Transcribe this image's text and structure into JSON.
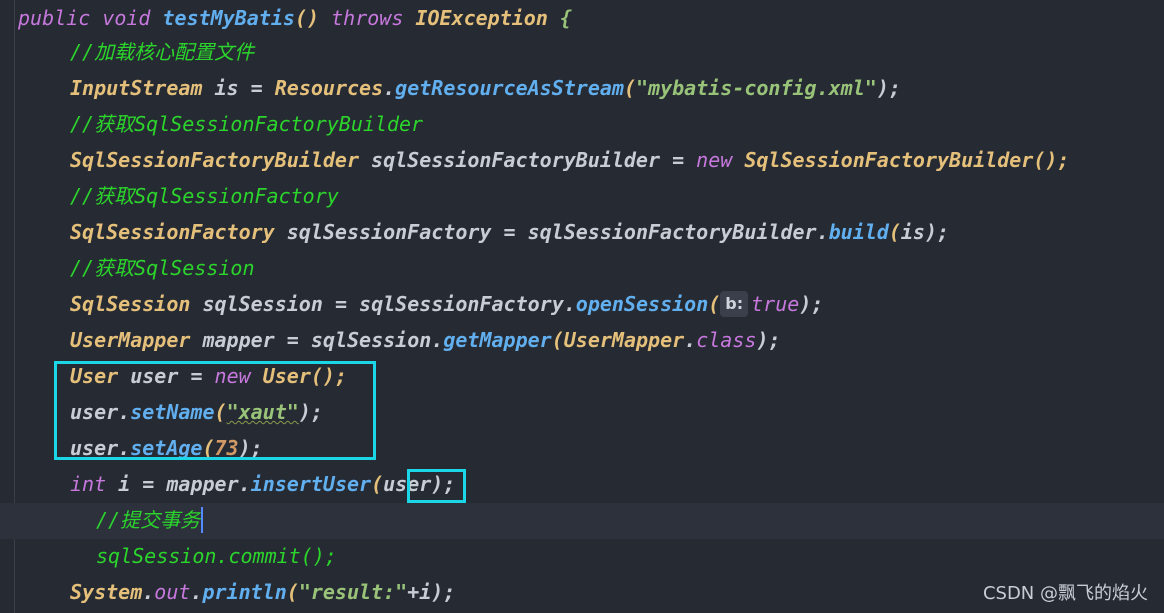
{
  "code": {
    "l1": {
      "mod1": "public",
      "mod2": "void",
      "name": "testMyBatis",
      "parens": "()",
      "throws": "throws",
      "exc": "IOException",
      "brace": "{"
    },
    "l2": {
      "comment": "//加载核心配置文件"
    },
    "l3": {
      "type": "InputStream",
      "var": "is",
      "eq": "=",
      "cls": "Resources",
      "dot": ".",
      "method": "getResourceAsStream",
      "open": "(",
      "arg": "\"mybatis-config.xml\"",
      "close": ");"
    },
    "l4": {
      "comment": "//获取SqlSessionFactoryBuilder"
    },
    "l5": {
      "type": "SqlSessionFactoryBuilder",
      "var": "sqlSessionFactoryBuilder",
      "eq": "=",
      "new": "new",
      "ctor": "SqlSessionFactoryBuilder",
      "close": "();"
    },
    "l6": {
      "comment": "//获取SqlSessionFactory"
    },
    "l7": {
      "type": "SqlSessionFactory",
      "var": "sqlSessionFactory",
      "eq": "=",
      "obj": "sqlSessionFactoryBuilder",
      "dot": ".",
      "method": "build",
      "open": "(",
      "arg": "is",
      "close": ");"
    },
    "l8": {
      "comment": "//获取SqlSession"
    },
    "l9": {
      "type": "SqlSession",
      "var": "sqlSession",
      "eq": "=",
      "obj": "sqlSessionFactory",
      "dot": ".",
      "method": "openSession",
      "open": "(",
      "hint": "b:",
      "arg": "true",
      "close": ");"
    },
    "l10": {
      "type": "UserMapper",
      "var": "mapper",
      "eq": "=",
      "obj": "sqlSession",
      "dot": ".",
      "method": "getMapper",
      "open": "(",
      "arg": "UserMapper",
      "dot2": ".",
      "kw": "class",
      "close": ");"
    },
    "l11": {
      "type": "User",
      "var": "user",
      "eq": "=",
      "new": "new",
      "ctor": "User",
      "close": "();"
    },
    "l12": {
      "obj": "user",
      "dot": ".",
      "method": "setName",
      "open": "(",
      "arg": "\"xaut\"",
      "close": ");"
    },
    "l13": {
      "obj": "user",
      "dot": ".",
      "method": "setAge",
      "open": "(",
      "arg": "73",
      "close": ");"
    },
    "l14": {
      "type": "int",
      "var": "i",
      "eq": "=",
      "obj": "mapper",
      "dot": ".",
      "method": "insertUser",
      "open": "(",
      "arg": "user",
      "close": ");"
    },
    "l15": {
      "comment": "//提交事务"
    },
    "l16": {
      "text": "sqlSession.commit();"
    },
    "l17": {
      "cls": "System",
      "dot": ".",
      "field": "out",
      "dot2": ".",
      "method": "println",
      "open": "(",
      "arg": "\"result:\"",
      "plus": "+i",
      "close": ");"
    }
  },
  "watermark": "CSDN @飘飞的焰火",
  "colors": {
    "background": "#262a33",
    "keyword": "#c678dd",
    "function": "#61afef",
    "type": "#e5c07b",
    "string": "#98c379",
    "number": "#d19a66",
    "comment": "#2bd52b",
    "highlight": "#1ad6e6"
  }
}
